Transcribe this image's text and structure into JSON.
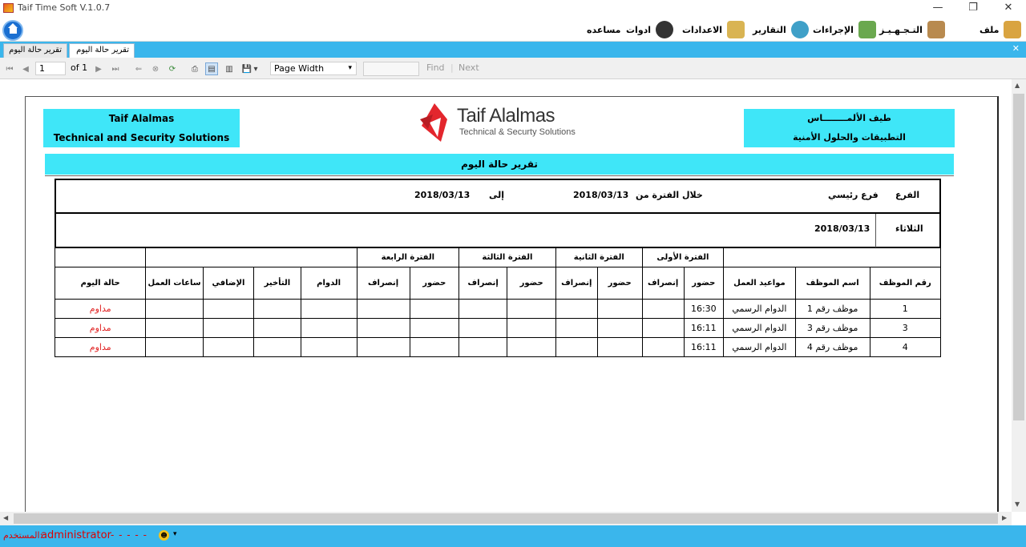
{
  "window": {
    "title": "Taif Time Soft V.1.0.7",
    "minimize_glyph": "—",
    "restore_glyph": "❐",
    "close_glyph": "✕"
  },
  "menu": {
    "items": [
      {
        "label": "ملف",
        "icon": "folder-icon",
        "color": "#d9a441"
      },
      {
        "label": "التـجـهـيـز",
        "icon": "box-icon",
        "color": "#b88a4f"
      },
      {
        "label": "الإجراءات",
        "icon": "procedures-icon",
        "color": "#6aa84f"
      },
      {
        "label": "التقارير",
        "icon": "reports-icon",
        "color": "#3fa0c8"
      },
      {
        "label": "الاعدادات",
        "icon": "settings-box-icon",
        "color": "#d9b453"
      },
      {
        "label": "ادوات",
        "icon": "tools-icon",
        "color": "#333333"
      },
      {
        "label": "مساعده",
        "icon": "gear-icon",
        "color": "#333333"
      }
    ]
  },
  "tabs": [
    {
      "label": "تقرير حالة اليوم"
    },
    {
      "label": "تقرير حالة اليوم"
    }
  ],
  "toolbar": {
    "page_current": "1",
    "page_total": "of 1",
    "zoom": "Page Width",
    "find_label": "Find",
    "next_label": "Next"
  },
  "report": {
    "company_en_name": "Taif Alalmas",
    "company_en_sub": "Technical and Security Solutions",
    "company_ar_name": "طيف الألمــــــــاس",
    "company_ar_sub": "التطبيقات والحلول الأمنية",
    "logo_name": "Taif Alalmas",
    "logo_sub": "Technical & Securty Solutions",
    "title": "تقرير حالة اليوم",
    "branch_label": "الفرع",
    "branch_value": "فرع رئيسي",
    "period_label": "خلال الفترة من",
    "period_from": "2018/03/13",
    "to_label": "إلى",
    "period_to": "2018/03/13",
    "day_label": "الثلاثاء",
    "day_date": "2018/03/13"
  },
  "table": {
    "groups": {
      "p1": "الفترة الأولى",
      "p2": "الفترة الثانية",
      "p3": "الفترة الثالثة",
      "p4": "الفترة الرابعة"
    },
    "headers": {
      "emp_no": "رقم الموظف",
      "emp_name": "اسم الموظف",
      "schedule": "مواعيد العمل",
      "in": "حضور",
      "out": "إنصراف",
      "duty": "الدوام",
      "late": "التأخير",
      "extra": "الإضافي",
      "hours": "ساعات العمل",
      "status": "حالة اليوم"
    },
    "rows": [
      {
        "no": "1",
        "name": "موظف رقم 1",
        "schedule": "الدوام الرسمي",
        "in1": "16:30",
        "status": "مداوم"
      },
      {
        "no": "3",
        "name": "موظف رقم 3",
        "schedule": "الدوام الرسمي",
        "in1": "16:11",
        "status": "مداوم"
      },
      {
        "no": "4",
        "name": "موظف رقم 4",
        "schedule": "الدوام الرسمي",
        "in1": "16:11",
        "status": "مداوم"
      }
    ]
  },
  "statusbar": {
    "user_label": "المستخدم:",
    "user_name": "administrator",
    "dashes": "- - - - -"
  },
  "colors": {
    "accent": "#3ab6ec",
    "report_band": "#3fe6f8",
    "status_red": "#e02020"
  }
}
